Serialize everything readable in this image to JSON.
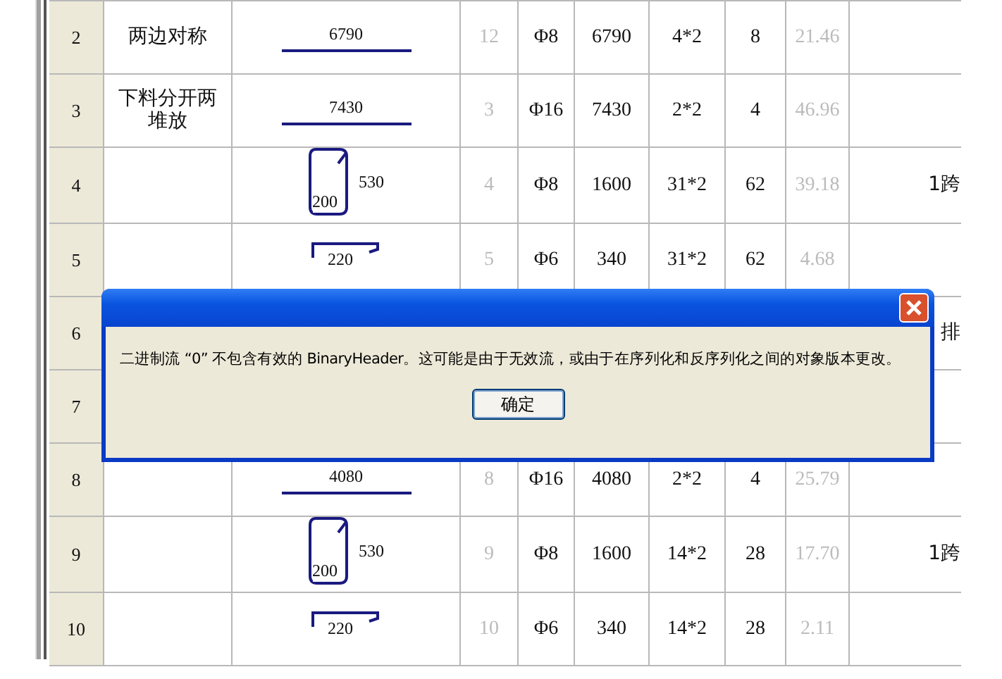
{
  "table": {
    "rows": [
      {
        "no": "2",
        "name": "两边对称",
        "shape": {
          "kind": "line",
          "labels": [
            "6790"
          ]
        },
        "index": "12",
        "dia": "Φ8",
        "length": "6790",
        "count": "4*2",
        "total": "8",
        "weight": "21.46"
      },
      {
        "no": "3",
        "name": "下料分开两堆放",
        "shape": {
          "kind": "line",
          "labels": [
            "7430"
          ]
        },
        "index": "3",
        "dia": "Φ16",
        "length": "7430",
        "count": "2*2",
        "total": "4",
        "weight": "46.96"
      },
      {
        "no": "4",
        "shape": {
          "kind": "stirrup",
          "labels": [
            "200",
            "530"
          ]
        },
        "index": "4",
        "dia": "Φ8",
        "length": "1600",
        "count": "31*2",
        "total": "62",
        "weight": "39.18",
        "note": "1跨"
      },
      {
        "no": "5",
        "shape": {
          "kind": "hook",
          "labels": [
            "220"
          ]
        },
        "index": "5",
        "dia": "Φ6",
        "length": "340",
        "count": "31*2",
        "total": "62",
        "weight": "4.68"
      },
      {
        "no": "6",
        "note": "排"
      },
      {
        "no": "7"
      },
      {
        "no": "8",
        "shape": {
          "kind": "line",
          "labels": [
            "4080"
          ]
        },
        "index": "8",
        "dia": "Φ16",
        "length": "4080",
        "count": "2*2",
        "total": "4",
        "weight": "25.79"
      },
      {
        "no": "9",
        "shape": {
          "kind": "stirrup",
          "labels": [
            "200",
            "530"
          ]
        },
        "index": "9",
        "dia": "Φ8",
        "length": "1600",
        "count": "14*2",
        "total": "28",
        "weight": "17.70",
        "note": "1跨"
      },
      {
        "no": "10",
        "shape": {
          "kind": "hook",
          "labels": [
            "220"
          ]
        },
        "index": "10",
        "dia": "Φ6",
        "length": "340",
        "count": "14*2",
        "total": "28",
        "weight": "2.11"
      }
    ]
  },
  "dialog": {
    "message": "二进制流 “0” 不包含有效的 BinaryHeader。这可能是由于无效流，或由于在序列化和反序列化之间的对象版本更改。",
    "button": "确定"
  }
}
